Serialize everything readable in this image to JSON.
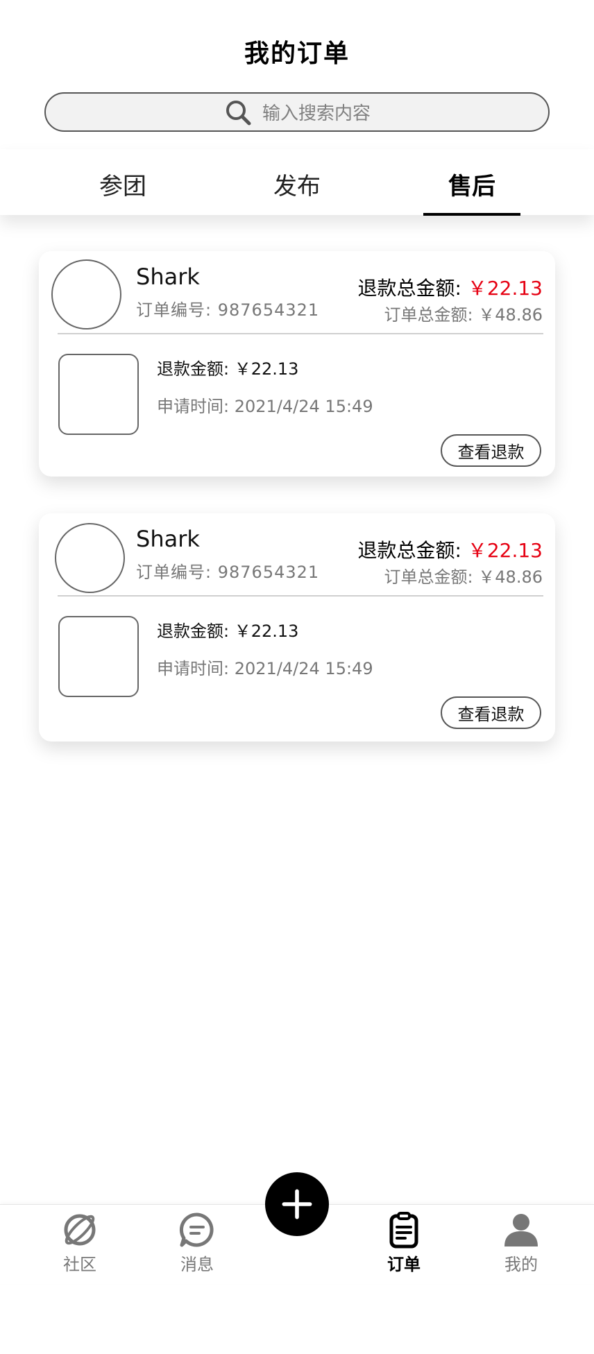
{
  "header": {
    "title": "我的订单"
  },
  "search": {
    "placeholder": "输入搜索内容",
    "icon": "search-icon"
  },
  "tabs": [
    {
      "label": "参团",
      "active": false
    },
    {
      "label": "发布",
      "active": false
    },
    {
      "label": "售后",
      "active": true
    }
  ],
  "orders": [
    {
      "shop_name": "Shark",
      "order_no_label": "订单编号:",
      "order_no": "987654321",
      "refund_total_label": "退款总金额:",
      "refund_total": "￥22.13",
      "order_total_label": "订单总金额:",
      "order_total": "￥48.86",
      "refund_amount_label": "退款金额:",
      "refund_amount": "￥22.13",
      "apply_time_label": "申请时间:",
      "apply_time": "2021/4/24 15:49",
      "button_label": "查看退款"
    },
    {
      "shop_name": "Shark",
      "order_no_label": "订单编号:",
      "order_no": "987654321",
      "refund_total_label": "退款总金额:",
      "refund_total": "￥22.13",
      "order_total_label": "订单总金额:",
      "order_total": "￥48.86",
      "refund_amount_label": "退款金额:",
      "refund_amount": "￥22.13",
      "apply_time_label": "申请时间:",
      "apply_time": "2021/4/24 15:49",
      "button_label": "查看退款"
    }
  ],
  "bottom_nav": [
    {
      "label": "社区",
      "icon": "planet-icon",
      "active": false
    },
    {
      "label": "消息",
      "icon": "chat-icon",
      "active": false
    },
    {
      "label": "订单",
      "icon": "clipboard-icon",
      "active": true
    },
    {
      "label": "我的",
      "icon": "user-icon",
      "active": false
    }
  ],
  "fab": {
    "icon": "plus-icon"
  },
  "colors": {
    "accent": "#000000",
    "price_red": "#e60012",
    "muted": "#777777"
  }
}
